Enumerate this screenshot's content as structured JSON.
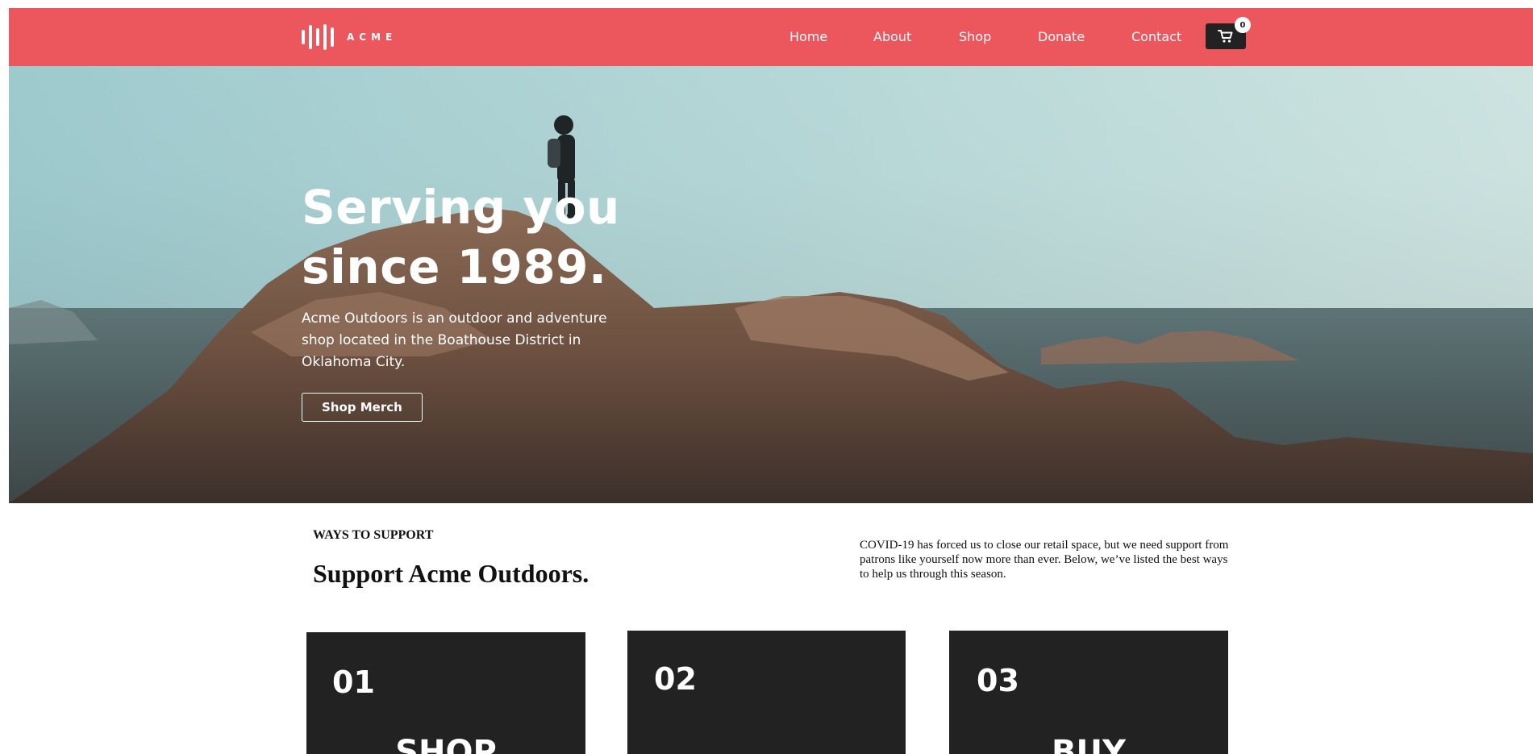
{
  "header": {
    "logo_text": "ACME",
    "nav": [
      "Home",
      "About",
      "Shop",
      "Donate",
      "Contact"
    ],
    "cart_count": "0",
    "colors": {
      "header_bg": "#ec565d",
      "cart_bg": "#222222"
    }
  },
  "hero": {
    "title_line1": "Serving you",
    "title_line2": "since 1989.",
    "description": "Acme Outdoors is an outdoor and adventure shop located in the Boathouse District in Oklahoma City.",
    "button_label": "Shop Merch"
  },
  "support": {
    "eyebrow": "WAYS TO SUPPORT",
    "title": "Support Acme Outdoors.",
    "description": "COVID-19 has forced us to close our retail space, but we need support from patrons like yourself now more than ever. Below, we’ve listed the best ways to help us through this season.",
    "cards": [
      {
        "number": "01",
        "title": "SHOP"
      },
      {
        "number": "02",
        "title": ""
      },
      {
        "number": "03",
        "title": "BUY"
      }
    ]
  },
  "icons": {
    "cart": "cart-icon",
    "logo": "logo-bars-icon"
  }
}
